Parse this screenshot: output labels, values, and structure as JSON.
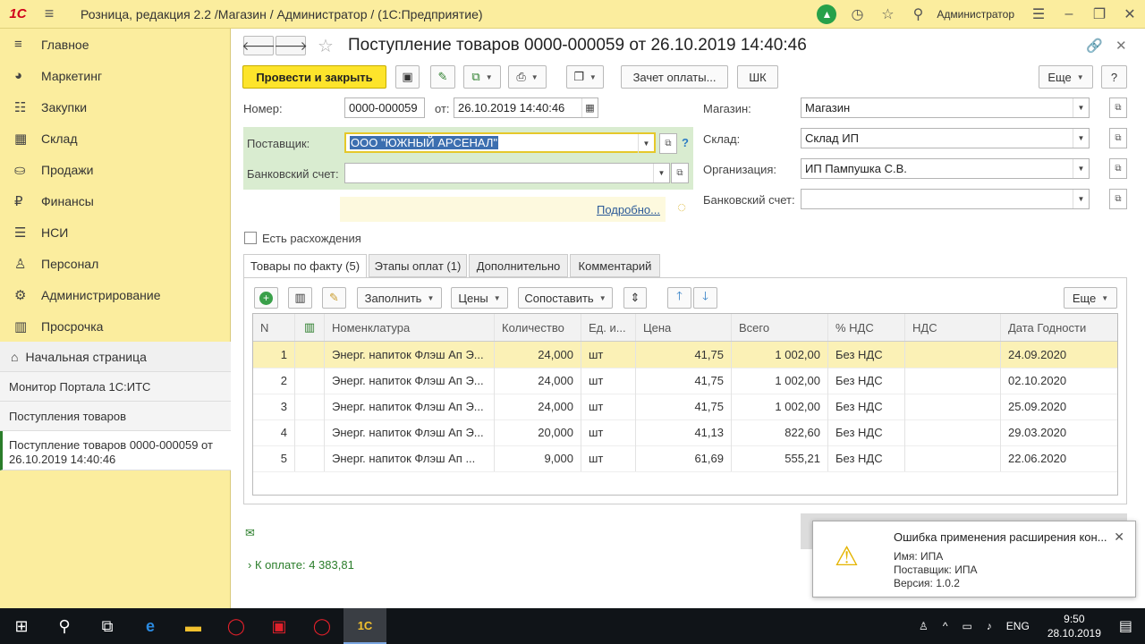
{
  "titlebar": {
    "logo": "1С",
    "title": "Розница, редакция 2.2 /Магазин / Администратор /  (1С:Предприятие)",
    "user": "Администратор"
  },
  "sidebar": {
    "items": [
      {
        "label": "Главное",
        "icon": "hamburger-icon"
      },
      {
        "label": "Маркетинг",
        "icon": "pie-icon"
      },
      {
        "label": "Закупки",
        "icon": "cart-icon"
      },
      {
        "label": "Склад",
        "icon": "grid-icon"
      },
      {
        "label": "Продажи",
        "icon": "basket-icon"
      },
      {
        "label": "Финансы",
        "icon": "ruble-icon"
      },
      {
        "label": "НСИ",
        "icon": "list-icon"
      },
      {
        "label": "Персонал",
        "icon": "person-icon"
      },
      {
        "label": "Администрирование",
        "icon": "gear-icon"
      },
      {
        "label": "Просрочка",
        "icon": "bar-icon"
      }
    ],
    "open": {
      "home": "Начальная страница",
      "items": [
        "Монитор Портала 1С:ИТС",
        "Поступления товаров"
      ],
      "active": "Поступление товаров 0000-000059 от 26.10.2019 14:40:46"
    }
  },
  "document": {
    "title": "Поступление товаров 0000-000059 от 26.10.2019 14:40:46"
  },
  "toolbar": {
    "post_close": "Провести и закрыть",
    "offset": "Зачет оплаты...",
    "barcode": "ШК",
    "more": "Еще",
    "help": "?"
  },
  "form": {
    "number_label": "Номер:",
    "number": "0000-000059",
    "date_label": "от:",
    "date": "26.10.2019 14:40:46",
    "supplier_label": "Поставщик:",
    "supplier": "ООО \"ЮЖНЫЙ АРСЕНАЛ\"",
    "bank_label": "Банковский счет:",
    "bank": "",
    "more_link": "Подробно...",
    "store_label": "Магазин:",
    "store": "Магазин",
    "warehouse_label": "Склад:",
    "warehouse": "Склад ИП",
    "org_label": "Организация:",
    "org": "ИП Пампушка С.В.",
    "bank2_label": "Банковский счет:",
    "bank2": "",
    "discrepancy_label": "Есть расхождения"
  },
  "tabs": [
    "Товары по факту (5)",
    "Этапы оплат (1)",
    "Дополнительно",
    "Комментарий"
  ],
  "table_toolbar": {
    "fill": "Заполнить",
    "prices": "Цены",
    "match": "Сопоставить",
    "more": "Еще"
  },
  "table": {
    "headers": [
      "N",
      "",
      "Номенклатура",
      "Количество",
      "Ед. и...",
      "Цена",
      "Всего",
      "% НДС",
      "НДС",
      "Дата Годности"
    ],
    "rows": [
      [
        "1",
        "",
        "Энерг. напиток Флэш Ап Э...",
        "24,000",
        "шт",
        "41,75",
        "1 002,00",
        "Без НДС",
        "",
        "24.09.2020"
      ],
      [
        "2",
        "",
        "Энерг. напиток Флэш Ап Э...",
        "24,000",
        "шт",
        "41,75",
        "1 002,00",
        "Без НДС",
        "",
        "02.10.2020"
      ],
      [
        "3",
        "",
        "Энерг. напиток Флэш Ап Э...",
        "24,000",
        "шт",
        "41,75",
        "1 002,00",
        "Без НДС",
        "",
        "25.09.2020"
      ],
      [
        "4",
        "",
        "Энерг. напиток Флэш Ап Э...",
        "20,000",
        "шт",
        "41,13",
        "822,60",
        "Без НДС",
        "",
        "29.03.2020"
      ],
      [
        "5",
        "",
        "Энерг. напиток Флэш Ап ...",
        "9,000",
        "шт",
        "61,69",
        "555,21",
        "Без НДС",
        "",
        "22.06.2020"
      ]
    ]
  },
  "footer": {
    "to_pay": "К оплате: 4 383,81"
  },
  "notification": {
    "title": "Ошибка применения расширения кон...",
    "line1": "Имя: ИПА",
    "line2": "Поставщик: ИПА",
    "line3": "Версия: 1.0.2"
  },
  "taskbar": {
    "lang": "ENG",
    "time": "9:50",
    "date": "28.10.2019"
  },
  "colors": {
    "accent_yellow": "#fbed9e",
    "primary_button": "#fde42b",
    "supplier_bg": "#d9ecd0",
    "selected_row": "#fbf1b6"
  }
}
